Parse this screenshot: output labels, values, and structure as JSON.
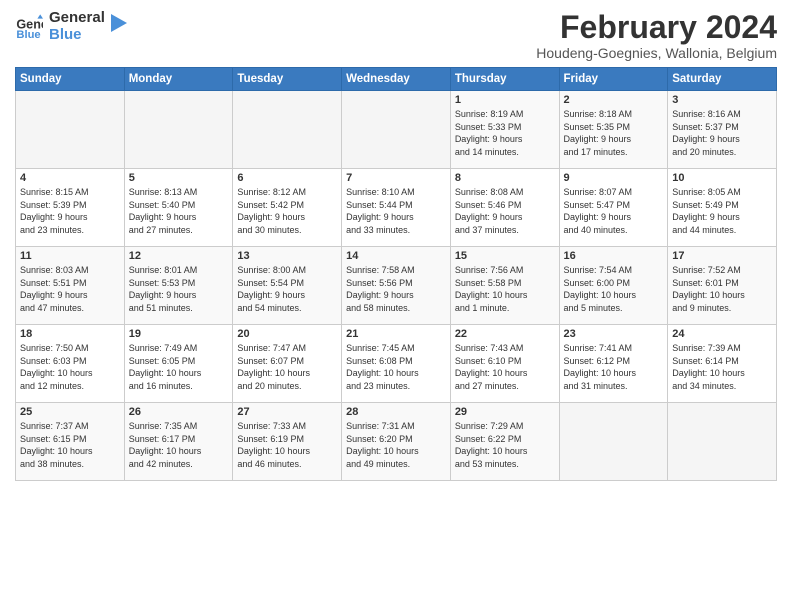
{
  "header": {
    "logo_line1": "General",
    "logo_line2": "Blue",
    "title": "February 2024",
    "subtitle": "Houdeng-Goegnies, Wallonia, Belgium"
  },
  "days_of_week": [
    "Sunday",
    "Monday",
    "Tuesday",
    "Wednesday",
    "Thursday",
    "Friday",
    "Saturday"
  ],
  "weeks": [
    [
      {
        "day": "",
        "info": ""
      },
      {
        "day": "",
        "info": ""
      },
      {
        "day": "",
        "info": ""
      },
      {
        "day": "",
        "info": ""
      },
      {
        "day": "1",
        "info": "Sunrise: 8:19 AM\nSunset: 5:33 PM\nDaylight: 9 hours\nand 14 minutes."
      },
      {
        "day": "2",
        "info": "Sunrise: 8:18 AM\nSunset: 5:35 PM\nDaylight: 9 hours\nand 17 minutes."
      },
      {
        "day": "3",
        "info": "Sunrise: 8:16 AM\nSunset: 5:37 PM\nDaylight: 9 hours\nand 20 minutes."
      }
    ],
    [
      {
        "day": "4",
        "info": "Sunrise: 8:15 AM\nSunset: 5:39 PM\nDaylight: 9 hours\nand 23 minutes."
      },
      {
        "day": "5",
        "info": "Sunrise: 8:13 AM\nSunset: 5:40 PM\nDaylight: 9 hours\nand 27 minutes."
      },
      {
        "day": "6",
        "info": "Sunrise: 8:12 AM\nSunset: 5:42 PM\nDaylight: 9 hours\nand 30 minutes."
      },
      {
        "day": "7",
        "info": "Sunrise: 8:10 AM\nSunset: 5:44 PM\nDaylight: 9 hours\nand 33 minutes."
      },
      {
        "day": "8",
        "info": "Sunrise: 8:08 AM\nSunset: 5:46 PM\nDaylight: 9 hours\nand 37 minutes."
      },
      {
        "day": "9",
        "info": "Sunrise: 8:07 AM\nSunset: 5:47 PM\nDaylight: 9 hours\nand 40 minutes."
      },
      {
        "day": "10",
        "info": "Sunrise: 8:05 AM\nSunset: 5:49 PM\nDaylight: 9 hours\nand 44 minutes."
      }
    ],
    [
      {
        "day": "11",
        "info": "Sunrise: 8:03 AM\nSunset: 5:51 PM\nDaylight: 9 hours\nand 47 minutes."
      },
      {
        "day": "12",
        "info": "Sunrise: 8:01 AM\nSunset: 5:53 PM\nDaylight: 9 hours\nand 51 minutes."
      },
      {
        "day": "13",
        "info": "Sunrise: 8:00 AM\nSunset: 5:54 PM\nDaylight: 9 hours\nand 54 minutes."
      },
      {
        "day": "14",
        "info": "Sunrise: 7:58 AM\nSunset: 5:56 PM\nDaylight: 9 hours\nand 58 minutes."
      },
      {
        "day": "15",
        "info": "Sunrise: 7:56 AM\nSunset: 5:58 PM\nDaylight: 10 hours\nand 1 minute."
      },
      {
        "day": "16",
        "info": "Sunrise: 7:54 AM\nSunset: 6:00 PM\nDaylight: 10 hours\nand 5 minutes."
      },
      {
        "day": "17",
        "info": "Sunrise: 7:52 AM\nSunset: 6:01 PM\nDaylight: 10 hours\nand 9 minutes."
      }
    ],
    [
      {
        "day": "18",
        "info": "Sunrise: 7:50 AM\nSunset: 6:03 PM\nDaylight: 10 hours\nand 12 minutes."
      },
      {
        "day": "19",
        "info": "Sunrise: 7:49 AM\nSunset: 6:05 PM\nDaylight: 10 hours\nand 16 minutes."
      },
      {
        "day": "20",
        "info": "Sunrise: 7:47 AM\nSunset: 6:07 PM\nDaylight: 10 hours\nand 20 minutes."
      },
      {
        "day": "21",
        "info": "Sunrise: 7:45 AM\nSunset: 6:08 PM\nDaylight: 10 hours\nand 23 minutes."
      },
      {
        "day": "22",
        "info": "Sunrise: 7:43 AM\nSunset: 6:10 PM\nDaylight: 10 hours\nand 27 minutes."
      },
      {
        "day": "23",
        "info": "Sunrise: 7:41 AM\nSunset: 6:12 PM\nDaylight: 10 hours\nand 31 minutes."
      },
      {
        "day": "24",
        "info": "Sunrise: 7:39 AM\nSunset: 6:14 PM\nDaylight: 10 hours\nand 34 minutes."
      }
    ],
    [
      {
        "day": "25",
        "info": "Sunrise: 7:37 AM\nSunset: 6:15 PM\nDaylight: 10 hours\nand 38 minutes."
      },
      {
        "day": "26",
        "info": "Sunrise: 7:35 AM\nSunset: 6:17 PM\nDaylight: 10 hours\nand 42 minutes."
      },
      {
        "day": "27",
        "info": "Sunrise: 7:33 AM\nSunset: 6:19 PM\nDaylight: 10 hours\nand 46 minutes."
      },
      {
        "day": "28",
        "info": "Sunrise: 7:31 AM\nSunset: 6:20 PM\nDaylight: 10 hours\nand 49 minutes."
      },
      {
        "day": "29",
        "info": "Sunrise: 7:29 AM\nSunset: 6:22 PM\nDaylight: 10 hours\nand 53 minutes."
      },
      {
        "day": "",
        "info": ""
      },
      {
        "day": "",
        "info": ""
      }
    ]
  ]
}
